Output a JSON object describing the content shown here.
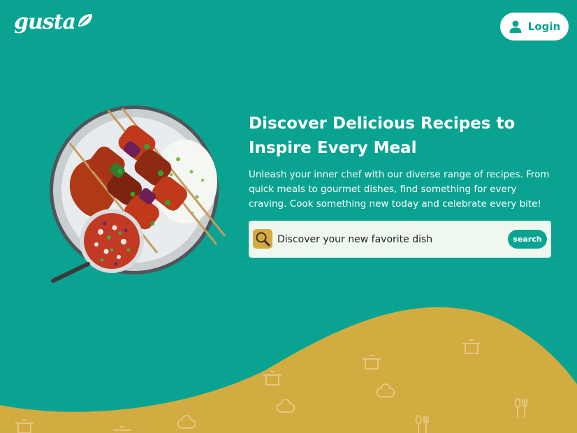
{
  "brand": {
    "name": "gusta"
  },
  "header": {
    "login_label": "Login"
  },
  "hero": {
    "title": "Discover Delicious Recipes to Inspire Every Meal",
    "description": "Unleash your inner chef with our diverse range of recipes. From quick meals to gourmet dishes, find something for every craving. Cook something new today and celebrate every bite!"
  },
  "search": {
    "placeholder": "Discover your new favorite dish",
    "button_label": "search"
  },
  "colors": {
    "primary": "#0aa391",
    "accent": "#d2ab41",
    "search_bg": "#eef8ee"
  },
  "icons": {
    "login": "user-icon",
    "search": "magnifier-icon",
    "decor": [
      "cooking-pot-icon",
      "chef-hat-icon",
      "cutlery-icon"
    ]
  }
}
